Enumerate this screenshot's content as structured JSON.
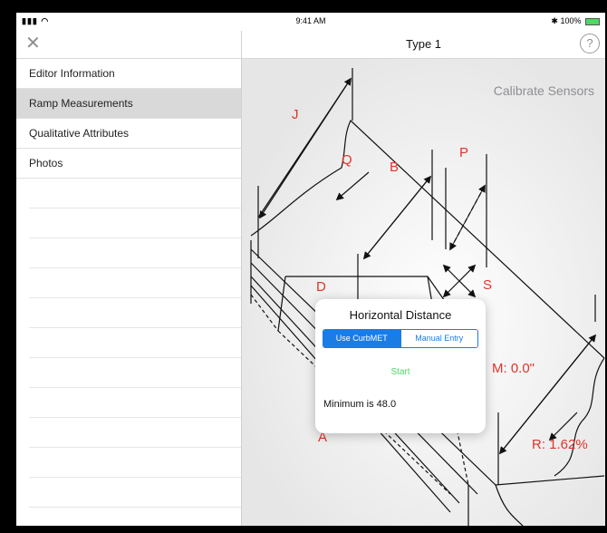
{
  "status": {
    "time": "9:41 AM",
    "battery": "100%"
  },
  "sidebar": {
    "items": [
      {
        "label": "Editor Information",
        "selected": false
      },
      {
        "label": "Ramp Measurements",
        "selected": true
      },
      {
        "label": "Qualitative Attributes",
        "selected": false
      },
      {
        "label": "Photos",
        "selected": false
      }
    ]
  },
  "main": {
    "title": "Type 1",
    "help_label": "?",
    "calibrate_label": "Calibrate Sensors",
    "diagram_labels": {
      "j": "J",
      "q": "Q",
      "b": "B",
      "p": "P",
      "s": "S",
      "d": "D",
      "a": "A",
      "m": "M: 0.0\"",
      "r": "R: 1.62%"
    }
  },
  "popup": {
    "title": "Horizontal Distance",
    "seg_use": "Use CurbMET",
    "seg_manual": "Manual Entry",
    "start": "Start",
    "minimum": "Minimum is 48.0"
  },
  "colors": {
    "accent": "#1a7ce5",
    "label_red": "#e0342b",
    "start_green": "#4cd964",
    "selected_row": "#d9d9d9"
  }
}
